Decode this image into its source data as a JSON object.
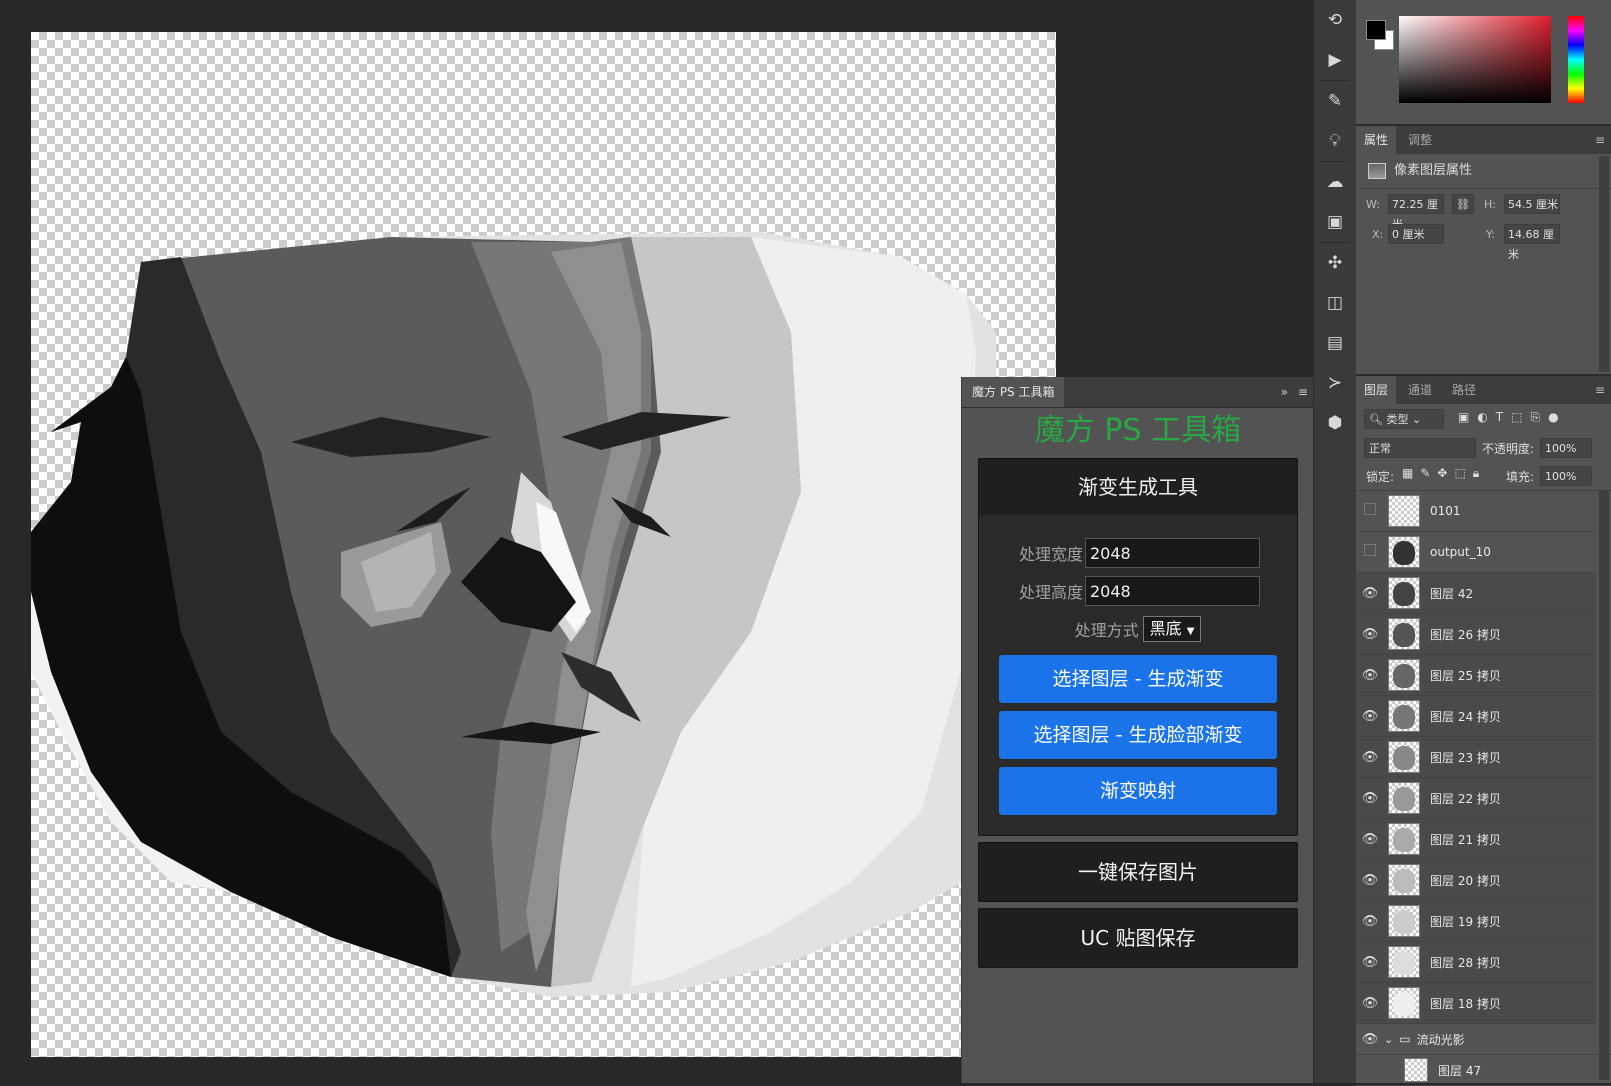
{
  "plugin": {
    "tab_label": "魔方 PS 工具箱",
    "collapse_icon": "»",
    "menu_icon": "≡",
    "title": "魔方 PS 工具箱",
    "title_color": "#28a745",
    "gradient_section": {
      "header": "渐变生成工具",
      "width_label": "处理宽度",
      "width_value": "2048",
      "height_label": "处理高度",
      "height_value": "2048",
      "method_label": "处理方式",
      "method_value": "黑底",
      "btn_gradient": "选择图层 - 生成渐变",
      "btn_face_gradient": "选择图层 - 生成脸部渐变",
      "btn_gradient_map": "渐变映射"
    },
    "save_section": {
      "label": "一键保存图片"
    },
    "uc_section": {
      "label": "UC 贴图保存"
    },
    "button_color": "#1a73e8"
  },
  "properties": {
    "tab_active": "属性",
    "tab_other": "调整",
    "title": "像素图层属性",
    "w_label": "W:",
    "w_value": "72.25 厘米",
    "h_label": "H:",
    "h_value": "54.5 厘米",
    "x_label": "X:",
    "x_value": "0 厘米",
    "y_label": "Y:",
    "y_value": "14.68 厘米"
  },
  "layers": {
    "tabs": [
      "图层",
      "通道",
      "路径"
    ],
    "filter_kind": "类型",
    "blend_mode": "正常",
    "opacity_label": "不透明度:",
    "opacity_value": "100%",
    "lock_label": "锁定:",
    "fill_label": "填充:",
    "fill_value": "100%",
    "items": [
      {
        "name": "0101",
        "visible": false
      },
      {
        "name": "output_10",
        "visible": false
      },
      {
        "name": "图层 42",
        "visible": true
      },
      {
        "name": "图层 26 拷贝",
        "visible": true
      },
      {
        "name": "图层 25 拷贝",
        "visible": true
      },
      {
        "name": "图层 24 拷贝",
        "visible": true
      },
      {
        "name": "图层 23 拷贝",
        "visible": true
      },
      {
        "name": "图层 22 拷贝",
        "visible": true
      },
      {
        "name": "图层 21 拷贝",
        "visible": true
      },
      {
        "name": "图层 20 拷贝",
        "visible": true
      },
      {
        "name": "图层 19 拷贝",
        "visible": true
      },
      {
        "name": "图层 28 拷贝",
        "visible": true
      },
      {
        "name": "图层 18 拷贝",
        "visible": true
      }
    ],
    "group_name": "流动光影",
    "sub_item": "图层 47"
  },
  "toolstrip": {
    "icons": [
      "history-icon",
      "play-icon",
      "brush-preset-icon",
      "lightbulb-icon",
      "cc-libraries-icon",
      "image-icon",
      "adjust-icon",
      "3d-icon",
      "image-icon-2",
      "console-icon",
      "cube-icon"
    ]
  },
  "colors": {
    "foreground": "#000000",
    "background": "#ffffff"
  }
}
